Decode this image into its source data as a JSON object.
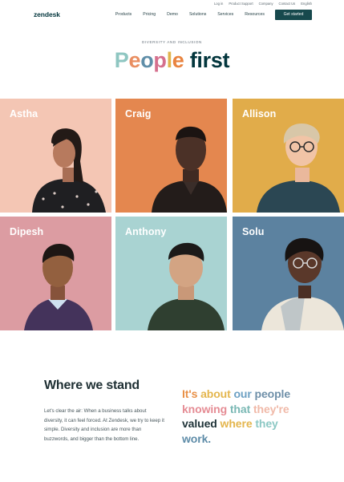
{
  "utility_nav": [
    "Log in",
    "Product Support",
    "Company",
    "Contact Us",
    "English"
  ],
  "header": {
    "logo": "zendesk",
    "nav_items": [
      "Products",
      "Pricing",
      "Demo",
      "Solutions",
      "Services",
      "Resources"
    ],
    "cta_label": "Get started"
  },
  "hero": {
    "eyebrow": "DIVERSITY AND INCLUSION",
    "title_letters": [
      {
        "char": "P",
        "color": "#8ec6c1"
      },
      {
        "char": "e",
        "color": "#e98e61"
      },
      {
        "char": "o",
        "color": "#5f8ea8"
      },
      {
        "char": "p",
        "color": "#d56f8d"
      },
      {
        "char": "l",
        "color": "#e0b34d"
      },
      {
        "char": "e",
        "color": "#e9833f"
      }
    ],
    "title_rest": "first"
  },
  "people": [
    {
      "name": "Astha",
      "bg": "#f4c6b4"
    },
    {
      "name": "Craig",
      "bg": "#e4874f"
    },
    {
      "name": "Allison",
      "bg": "#e1ac4a"
    },
    {
      "name": "Dipesh",
      "bg": "#dc9ca2"
    },
    {
      "name": "Anthony",
      "bg": "#a9d3d2"
    },
    {
      "name": "Solu",
      "bg": "#5c82a0"
    }
  ],
  "stand": {
    "title": "Where we stand",
    "body": "Let's clear the air: When a business talks about diversity, it can feel forced. At Zendesk, we try to keep it simple. Diversity and inclusion are more than buzzwords, and bigger than the bottom line."
  },
  "quote": [
    {
      "text": "It's ",
      "color": "#e88f45"
    },
    {
      "text": "about ",
      "color": "#e4b64e"
    },
    {
      "text": "our ",
      "color": "#6ca0c3"
    },
    {
      "text": "people",
      "color": "#6e8fa8"
    },
    {
      "br": true
    },
    {
      "text": "knowing ",
      "color": "#e58c94"
    },
    {
      "text": "that ",
      "color": "#7ab8b4"
    },
    {
      "text": "they're",
      "color": "#f0b9a8"
    },
    {
      "br": true
    },
    {
      "text": "valued ",
      "color": "#1f3338"
    },
    {
      "text": "where ",
      "color": "#e4b64e"
    },
    {
      "text": "they",
      "color": "#8cc8c4"
    },
    {
      "br": true
    },
    {
      "text": "work.",
      "color": "#5e8ca8"
    }
  ]
}
